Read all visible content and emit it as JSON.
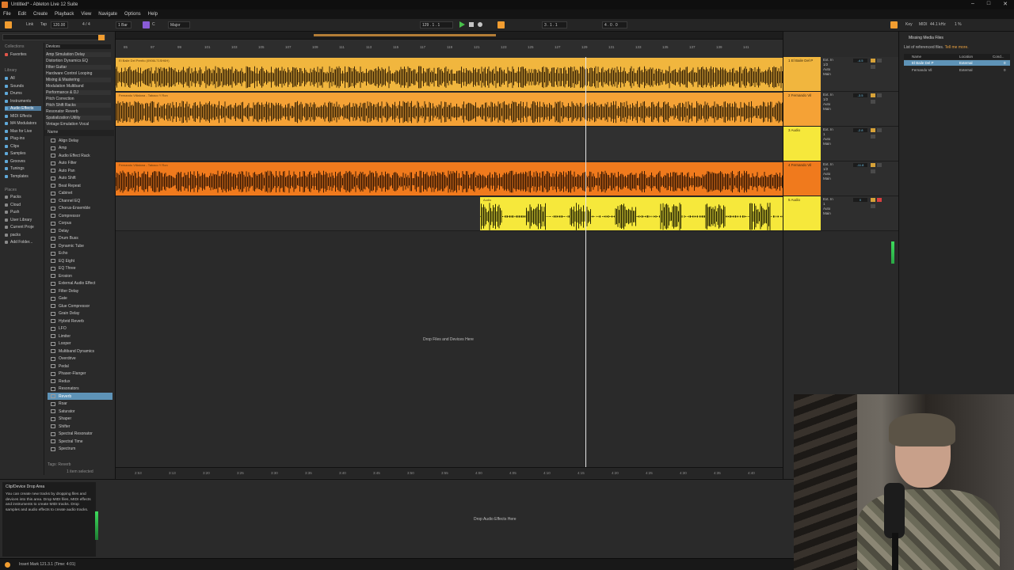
{
  "window": {
    "title": "Untitled* - Ableton Live 12 Suite"
  },
  "menu": [
    "File",
    "Edit",
    "Create",
    "Playback",
    "View",
    "Navigate",
    "Options",
    "Help"
  ],
  "controlbar": {
    "link": "Link",
    "tap": "Tap",
    "tempo": "120.00",
    "signature": "4 / 4",
    "quant": "1 Bar",
    "key": "C",
    "scale": "Major",
    "position": "129 . 1 . 1",
    "loop_start": "3 . 1 . 1",
    "loop_len": "4 . 0 . 0",
    "key_label": "Key",
    "midi_label": "MIDI",
    "sample_rate": "44.1 kHz",
    "cpu": "1 %"
  },
  "browser": {
    "search_placeholder": "Search (Ctrl + F)",
    "collections_head": "Collections",
    "favorites": "Favorites",
    "library_head": "Library",
    "library": [
      {
        "label": "All",
        "sel": false
      },
      {
        "label": "Sounds",
        "sel": false
      },
      {
        "label": "Drums",
        "sel": false
      },
      {
        "label": "Instruments",
        "sel": false
      },
      {
        "label": "Audio Effects",
        "sel": true
      },
      {
        "label": "MIDI Effects",
        "sel": false
      },
      {
        "label": "M4 Modulators",
        "sel": false
      },
      {
        "label": "Max for Live",
        "sel": false
      },
      {
        "label": "Plug-ins",
        "sel": false
      },
      {
        "label": "Clips",
        "sel": false
      },
      {
        "label": "Samples",
        "sel": false
      },
      {
        "label": "Grooves",
        "sel": false
      },
      {
        "label": "Tunings",
        "sel": false
      },
      {
        "label": "Templates",
        "sel": false
      }
    ],
    "places_head": "Places",
    "places": [
      "Packs",
      "Cloud",
      "Push",
      "User Library",
      "Current Proje",
      "packs",
      "Add Folder..."
    ],
    "devices_label": "Devices",
    "categories": [
      "Amp Simulation  Delay",
      "Distortion  Dynamics  EQ",
      "Filter  Guitar",
      "Hardware Control  Looping",
      "Mixing & Mastering",
      "Modulation  Multiband",
      "Performance & DJ",
      "Pitch Correction",
      "Pitch Shift  Racks",
      "Resonator  Reverb",
      "Spatialization  Utility",
      "Vintage Emulation  Vocal"
    ],
    "name_head": "Name",
    "devices": [
      "Align Delay",
      "Amp",
      "Audio Effect Rack",
      "Auto Filter",
      "Auto Pan",
      "Auto Shift",
      "Beat Repeat",
      "Cabinet",
      "Channel EQ",
      "Chorus-Ensemble",
      "Compressor",
      "Corpus",
      "Delay",
      "Drum Buss",
      "Dynamic Tube",
      "Echo",
      "EQ Eight",
      "EQ Three",
      "Erosion",
      "External Audio Effect",
      "Filter Delay",
      "Gate",
      "Glue Compressor",
      "Grain Delay",
      "Hybrid Reverb",
      "LFO",
      "Limiter",
      "Looper",
      "Multiband Dynamics",
      "Overdrive",
      "Pedal",
      "Phaser-Flanger",
      "Redux",
      "Resonators",
      "Reverb",
      "Roar",
      "Saturator",
      "Shaper",
      "Shifter",
      "Spectral Resonator",
      "Spectral Time",
      "Spectrum"
    ],
    "selected_device_index": 34,
    "footer_tags": "Tags: Reverb",
    "footer_sel": "1 item selected"
  },
  "arrangement": {
    "ruler": [
      "85",
      "97",
      "99",
      "101",
      "103",
      "105",
      "107",
      "109",
      "111",
      "113",
      "115",
      "117",
      "119",
      "121",
      "123",
      "125",
      "127",
      "129",
      "131",
      "133",
      "135",
      "137",
      "139",
      "141"
    ],
    "time_ruler": [
      "2:53",
      "3:13",
      "3:20",
      "3:25",
      "3:30",
      "3:35",
      "3:40",
      "3:45",
      "3:50",
      "3:55",
      "4:00",
      "4:05",
      "4:10",
      "4:15",
      "4:20",
      "4:25",
      "4:30",
      "4:35",
      "4:40"
    ],
    "clips": [
      {
        "name": "El Baile Del Perrito (0906L71SH6H)",
        "color": "#f1b63e",
        "wave": "#3a2507"
      },
      {
        "name": "Fernando Villalona - Tabaco Y Ron",
        "color": "#f5a236",
        "wave": "#3a2507"
      },
      {
        "name": "Fernando Villalona - Tabaco Y Ron",
        "color": "#f07a1d",
        "wave": "#3a1a04"
      },
      {
        "name": "Audio",
        "color": "#f6e83b",
        "wave": "#2b2a05"
      }
    ],
    "drop_text": "Drop Files and Devices Here"
  },
  "tracks": [
    {
      "name": "1 El Baile Del P",
      "color": "#f1b63e",
      "in": "Ext. In",
      "ch": "1/2",
      "mon": "Auto",
      "out": "Main",
      "vol": "-4.5"
    },
    {
      "name": "2 Fernando Vil",
      "color": "#f5a236",
      "in": "Ext. In",
      "ch": "1/2",
      "mon": "Auto",
      "out": "Main",
      "vol": "-3.5"
    },
    {
      "name": "3 Audio",
      "color": "#f6e83b",
      "in": "Ext. In",
      "ch": "1",
      "mon": "Auto",
      "out": "Main",
      "vol": "-2.8"
    },
    {
      "name": "4 Fernando Vil",
      "color": "#f07a1d",
      "in": "Ext. In",
      "ch": "1/2",
      "mon": "Auto",
      "out": "Main",
      "vol": "-11.8"
    },
    {
      "name": "5 Audio",
      "color": "#f6e83b",
      "in": "Ext. In",
      "ch": "1",
      "mon": "Auto",
      "out": "Main",
      "vol": "0"
    }
  ],
  "missing_files": {
    "title": "Missing Media Files",
    "subtitle": "List of referenced files.",
    "link": "Tell me more.",
    "cols": [
      "Name",
      "Location",
      "Cond..."
    ],
    "rows": [
      {
        "name": "El Baile Del P",
        "location": "External",
        "cond": "0",
        "sel": true
      },
      {
        "name": "Fernando Vil",
        "location": "External",
        "cond": "0",
        "sel": false
      }
    ]
  },
  "info": {
    "title": "Clip/Device Drop Area",
    "text": "You can create new tracks by dropping files and devices into this area. Drop MIDI files, MIDI effects and instruments to create MIDI tracks. Drop samples and audio effects to create audio tracks."
  },
  "detail": {
    "drop_effects": "Drop Audio Effects Here"
  },
  "status": {
    "text": "Insert Mark 121.3.1 (Time: 4:01)"
  }
}
